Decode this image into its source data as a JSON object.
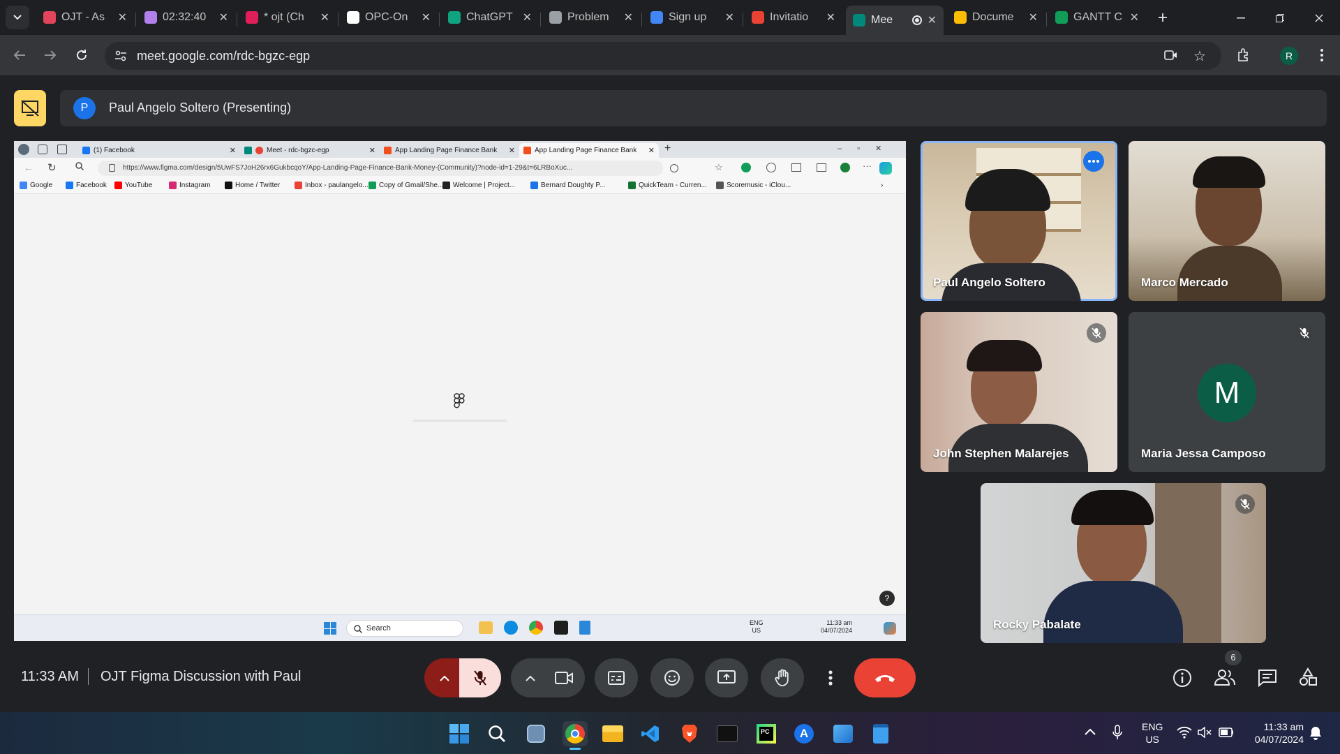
{
  "browser": {
    "tabs": [
      {
        "title": "OJT - As",
        "fav_color": "#e2445c"
      },
      {
        "title": "02:32:40",
        "fav_color": "#b37feb"
      },
      {
        "title": "* ojt (Ch",
        "fav_color": "#e01e5a"
      },
      {
        "title": "OPC-On",
        "fav_color": "#ffffff"
      },
      {
        "title": "ChatGPT",
        "fav_color": "#10a37f"
      },
      {
        "title": "Problem",
        "fav_color": "#9aa0a6"
      },
      {
        "title": "Sign up",
        "fav_color": "#4285f4"
      },
      {
        "title": "Invitatio",
        "fav_color": "#ea4335"
      },
      {
        "title": "Mee",
        "fav_color": "#00897b"
      },
      {
        "title": "Docume",
        "fav_color": "#fbbc04"
      },
      {
        "title": "GANTT C",
        "fav_color": "#0f9d58"
      }
    ],
    "address": "meet.google.com/rdc-bgzc-egp",
    "profile_initial": "R"
  },
  "meet": {
    "presenter_initial": "P",
    "presenting_text": "Paul Angelo Soltero (Presenting)",
    "time": "11:33 AM",
    "meeting_title": "OJT Figma Discussion with Paul",
    "people_count": "6",
    "participants": [
      {
        "name": "Paul Angelo Soltero",
        "muted": false,
        "active": true
      },
      {
        "name": "Marco Mercado",
        "muted": false
      },
      {
        "name": "John Stephen Malarejes",
        "muted": true
      },
      {
        "name": "Maria Jessa Camposo",
        "muted": true,
        "initial": "M",
        "avatar_color": "#0b5e45"
      },
      {
        "name": "Rocky Pabalate",
        "muted": true
      }
    ]
  },
  "shared": {
    "tabs": [
      "(1) Facebook",
      "Meet - rdc-bgzc-egp",
      "App Landing Page Finance Bank",
      "App Landing Page Finance Bank"
    ],
    "url": "https://www.figma.com/design/5UwFS7JoH26rx6GukbcqoY/App-Landing-Page-Finance-Bank-Money-(Community)?node-id=1-29&t=6LRBoXuc...",
    "bookmarks": [
      {
        "label": "Google",
        "color": "#4285f4"
      },
      {
        "label": "Facebook",
        "color": "#1877f2"
      },
      {
        "label": "YouTube",
        "color": "#ff0000"
      },
      {
        "label": "Instagram",
        "color": "#d62976"
      },
      {
        "label": "Home / Twitter",
        "color": "#111111"
      },
      {
        "label": "Inbox - paulangelo...",
        "color": "#ea4335"
      },
      {
        "label": "Copy of Gmail/She...",
        "color": "#0f9d58"
      },
      {
        "label": "Welcome | Project...",
        "color": "#222222"
      },
      {
        "label": "Bernard Doughty P...",
        "color": "#1a73e8"
      },
      {
        "label": "QuickTeam - Curren...",
        "color": "#137333"
      },
      {
        "label": "Scoremusic - iClou...",
        "color": "#555555"
      }
    ],
    "taskbar": {
      "search_placeholder": "Search",
      "lang": "ENG",
      "region": "US",
      "time": "11:33 am",
      "date": "04/07/2024"
    },
    "help": "?"
  },
  "os_taskbar": {
    "lang": "ENG",
    "region": "US",
    "time": "11:33 am",
    "date": "04/07/2024"
  }
}
